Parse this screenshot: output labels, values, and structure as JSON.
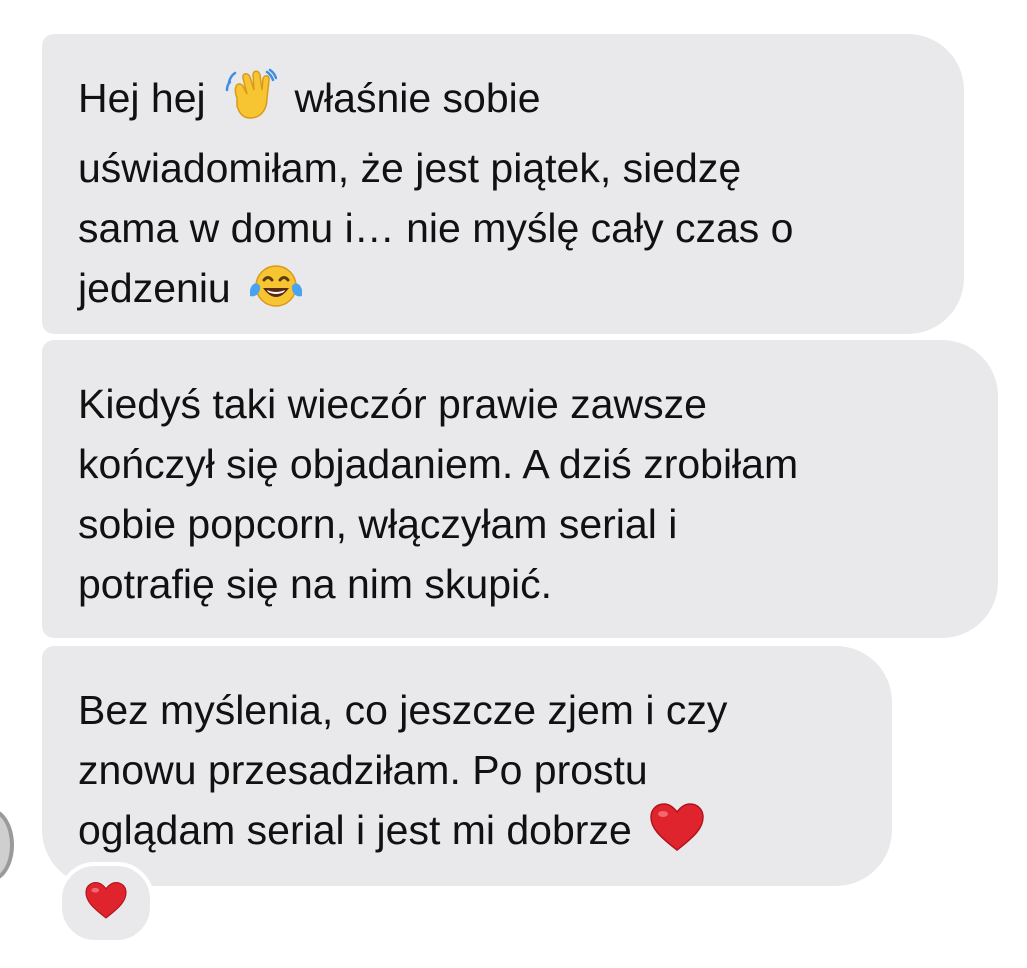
{
  "messages": [
    {
      "lines": [
        {
          "before": "Hej hej",
          "emoji": "waving-hand",
          "after": "właśnie sobie"
        },
        {
          "text": "uświadomiłam, że jest piątek, siedzę"
        },
        {
          "text": "sama w domu i… nie myślę cały czas o"
        },
        {
          "before": "jedzeniu",
          "emoji": "tears-of-joy",
          "after": ""
        }
      ]
    },
    {
      "lines": [
        {
          "text": "Kiedyś taki wieczór prawie zawsze"
        },
        {
          "text": "kończył się objadaniem. A dziś zrobiłam"
        },
        {
          "text": "sobie popcorn, włączyłam serial i"
        },
        {
          "text": "potrafię się na nim skupić."
        }
      ]
    },
    {
      "lines": [
        {
          "text": "Bez myślenia, co jeszcze zjem i czy"
        },
        {
          "text": "znowu przesadziłam. Po prostu"
        },
        {
          "before": "oglądam serial i jest mi dobrze",
          "emoji": "red-heart",
          "after": ""
        }
      ]
    }
  ],
  "reaction": {
    "emoji": "red-heart"
  },
  "colors": {
    "bubble": "#e9e9eb",
    "text": "#111111",
    "heart": "#e0242e",
    "emoji_yellow": "#f7c531"
  }
}
